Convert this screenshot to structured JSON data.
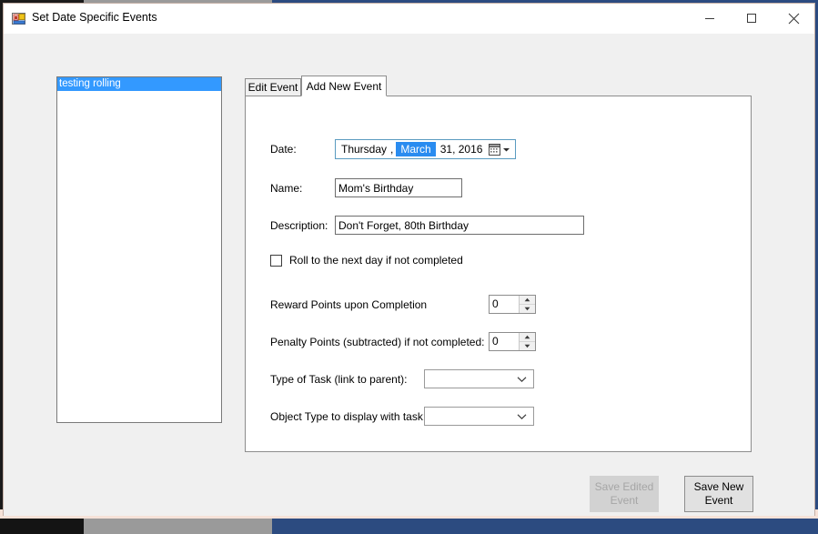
{
  "window": {
    "title": "Set Date Specific Events",
    "app_icon": "windows-forms-icon",
    "controls": {
      "minimize": "minimize-icon",
      "maximize": "maximize-icon",
      "close": "close-icon"
    }
  },
  "event_list": {
    "items": [
      {
        "label": "testing rolling",
        "selected": true
      }
    ]
  },
  "tabs": [
    {
      "id": "edit-event",
      "label": "Edit Event",
      "active": false
    },
    {
      "id": "add-new-event",
      "label": "Add New Event",
      "active": true
    }
  ],
  "form": {
    "date": {
      "label": "Date:",
      "weekday": "Thursday",
      "separator": ",",
      "month": "March",
      "day_year": "31, 2016",
      "calendar_icon": "calendar-icon",
      "dropdown_icon": "chevron-down-icon"
    },
    "name": {
      "label": "Name:",
      "value": "Mom's Birthday",
      "placeholder": ""
    },
    "description": {
      "label": "Description:",
      "value": "Don't Forget, 80th Birthday",
      "placeholder": ""
    },
    "roll_checkbox": {
      "label": "Roll to the next day if not completed",
      "checked": false
    },
    "reward_points": {
      "label": "Reward Points upon Completion",
      "value": "0"
    },
    "penalty_points": {
      "label": "Penalty Points (subtracted) if not completed:",
      "value": "0"
    },
    "task_type": {
      "label": "Type of Task (link to parent):",
      "value": "",
      "dropdown_icon": "chevron-down-icon"
    },
    "object_type": {
      "label": "Object Type to display with task:",
      "value": "",
      "dropdown_icon": "chevron-down-icon"
    }
  },
  "buttons": {
    "save_edited_event": {
      "line1": "Save Edited",
      "line2": "Event",
      "enabled": false
    },
    "save_new_event": {
      "line1": "Save New",
      "line2": "Event",
      "enabled": true
    }
  },
  "colors": {
    "selection_blue": "#3399ff",
    "date_highlight": "#2a8cf0",
    "window_background": "#f0f0f0",
    "desktop_blue": "#2c4b80"
  }
}
